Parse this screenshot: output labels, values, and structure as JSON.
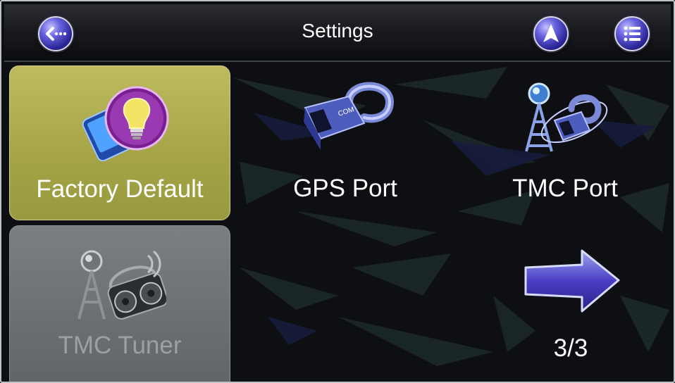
{
  "header": {
    "title": "Settings",
    "back_icon": "back-arrow-icon",
    "navigate_icon": "navigation-arrow-icon",
    "menu_icon": "list-menu-icon"
  },
  "tiles": [
    {
      "label": "Factory Default",
      "icon": "reset-bulb-icon",
      "state": "selected"
    },
    {
      "label": "GPS Port",
      "icon": "com-port-plug-icon",
      "state": "normal"
    },
    {
      "label": "TMC Port",
      "icon": "tmc-antenna-plug-icon",
      "state": "normal"
    },
    {
      "label": "TMC Tuner",
      "icon": "tmc-radio-icon",
      "state": "disabled"
    }
  ],
  "pager": {
    "next_icon": "next-page-arrow-icon",
    "page_text": "3/3"
  },
  "colors": {
    "selected_tile": "#a9a84a",
    "disabled_tile": "#6b7074",
    "button_blue": "#3a33b8",
    "background": "#0d0e12"
  }
}
